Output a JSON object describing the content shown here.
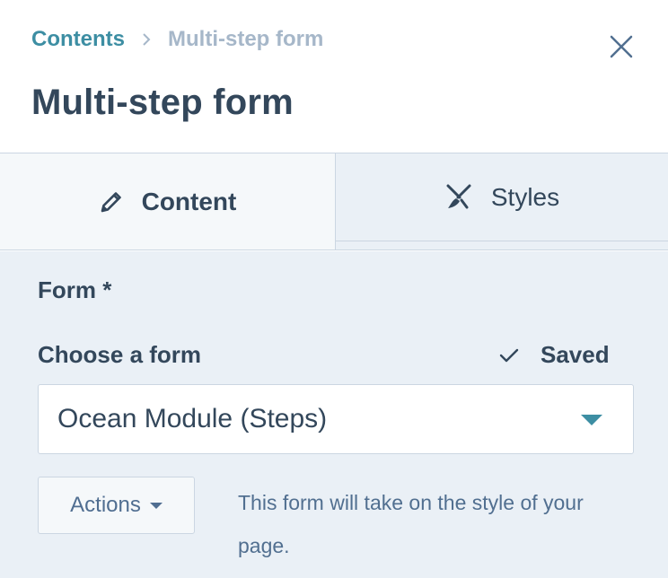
{
  "breadcrumb": {
    "parent": "Contents",
    "current": "Multi-step form"
  },
  "page": {
    "title": "Multi-step form"
  },
  "tabs": [
    {
      "label": "Content",
      "icon": "pencil-icon",
      "active": true
    },
    {
      "label": "Styles",
      "icon": "brush-icon",
      "active": false
    }
  ],
  "form": {
    "section_label": "Form *",
    "field_label": "Choose a form",
    "status": "Saved",
    "selected_value": "Ocean Module (Steps)",
    "actions_label": "Actions",
    "help_text": "This form will take on the style of your page."
  },
  "colors": {
    "link": "#3d8ea3",
    "text": "#33475b",
    "muted": "#a6b7c9",
    "panel": "#eaf0f6",
    "border": "#cbd6e2"
  }
}
